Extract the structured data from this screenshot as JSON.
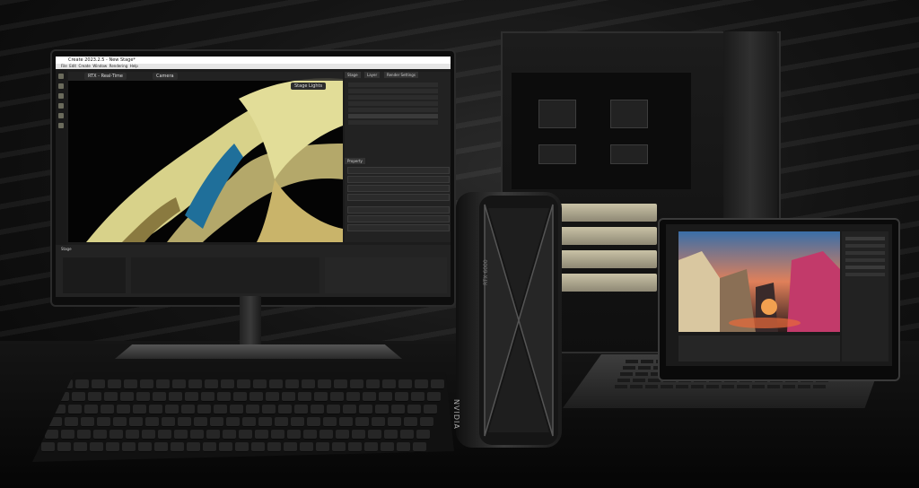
{
  "monitor": {
    "window_title": "Create 2023.2.5 - New Stage*",
    "menu": [
      "File",
      "Edit",
      "Create",
      "Window",
      "Rendering",
      "Help"
    ],
    "viewport_tabs": [
      "RTX - Real-Time",
      "Camera"
    ],
    "stage_lights_label": "Stage Lights",
    "panel_tabs": [
      "Stage",
      "Layer",
      "Render Settings"
    ],
    "property_tab": "Property",
    "stage_label": "Stage"
  },
  "gpu": {
    "brand_label": "NVIDIA",
    "model_label": "RTX 6000"
  },
  "colors": {
    "background": "#0b0b0b",
    "accent_fabric": "#d8d28a",
    "accent_blue": "#1f6f9a",
    "sunset": "#e86a3a"
  }
}
